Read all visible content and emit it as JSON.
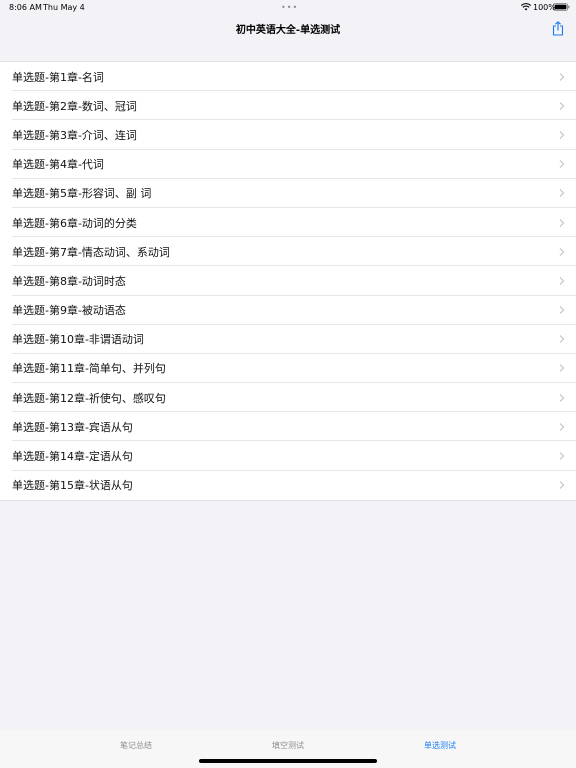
{
  "status_bar": {
    "time": "8:06 AM",
    "date": "Thu May 4",
    "dots": "•••",
    "battery": "100%"
  },
  "nav": {
    "title": "初中英语大全-单选测试",
    "share_icon": "share-icon"
  },
  "list": {
    "items": [
      {
        "label": "单选题-第1章-名词"
      },
      {
        "label": "单选题-第2章-数词、冠词"
      },
      {
        "label": "单选题-第3章-介词、连词"
      },
      {
        "label": "单选题-第4章-代词"
      },
      {
        "label": "单选题-第5章-形容词、副 词"
      },
      {
        "label": "单选题-第6章-动词的分类"
      },
      {
        "label": "单选题-第7章-情态动词、系动词"
      },
      {
        "label": "单选题-第8章-动词时态"
      },
      {
        "label": "单选题-第9章-被动语态"
      },
      {
        "label": "单选题-第10章-非谓语动词"
      },
      {
        "label": "单选题-第11章-简单句、并列句"
      },
      {
        "label": "单选题-第12章-祈使句、感叹句"
      },
      {
        "label": "单选题-第13章-宾语从句"
      },
      {
        "label": "单选题-第14章-定语从句"
      },
      {
        "label": "单选题-第15章-状语从句"
      }
    ]
  },
  "tab_bar": {
    "tabs": [
      {
        "label": "笔记总结",
        "active": false
      },
      {
        "label": "填空测试",
        "active": false
      },
      {
        "label": "单选测试",
        "active": true
      }
    ]
  },
  "colors": {
    "accent": "#1a7cf5",
    "background": "#f2f2f7",
    "inactive_tab": "#8e8e93"
  }
}
